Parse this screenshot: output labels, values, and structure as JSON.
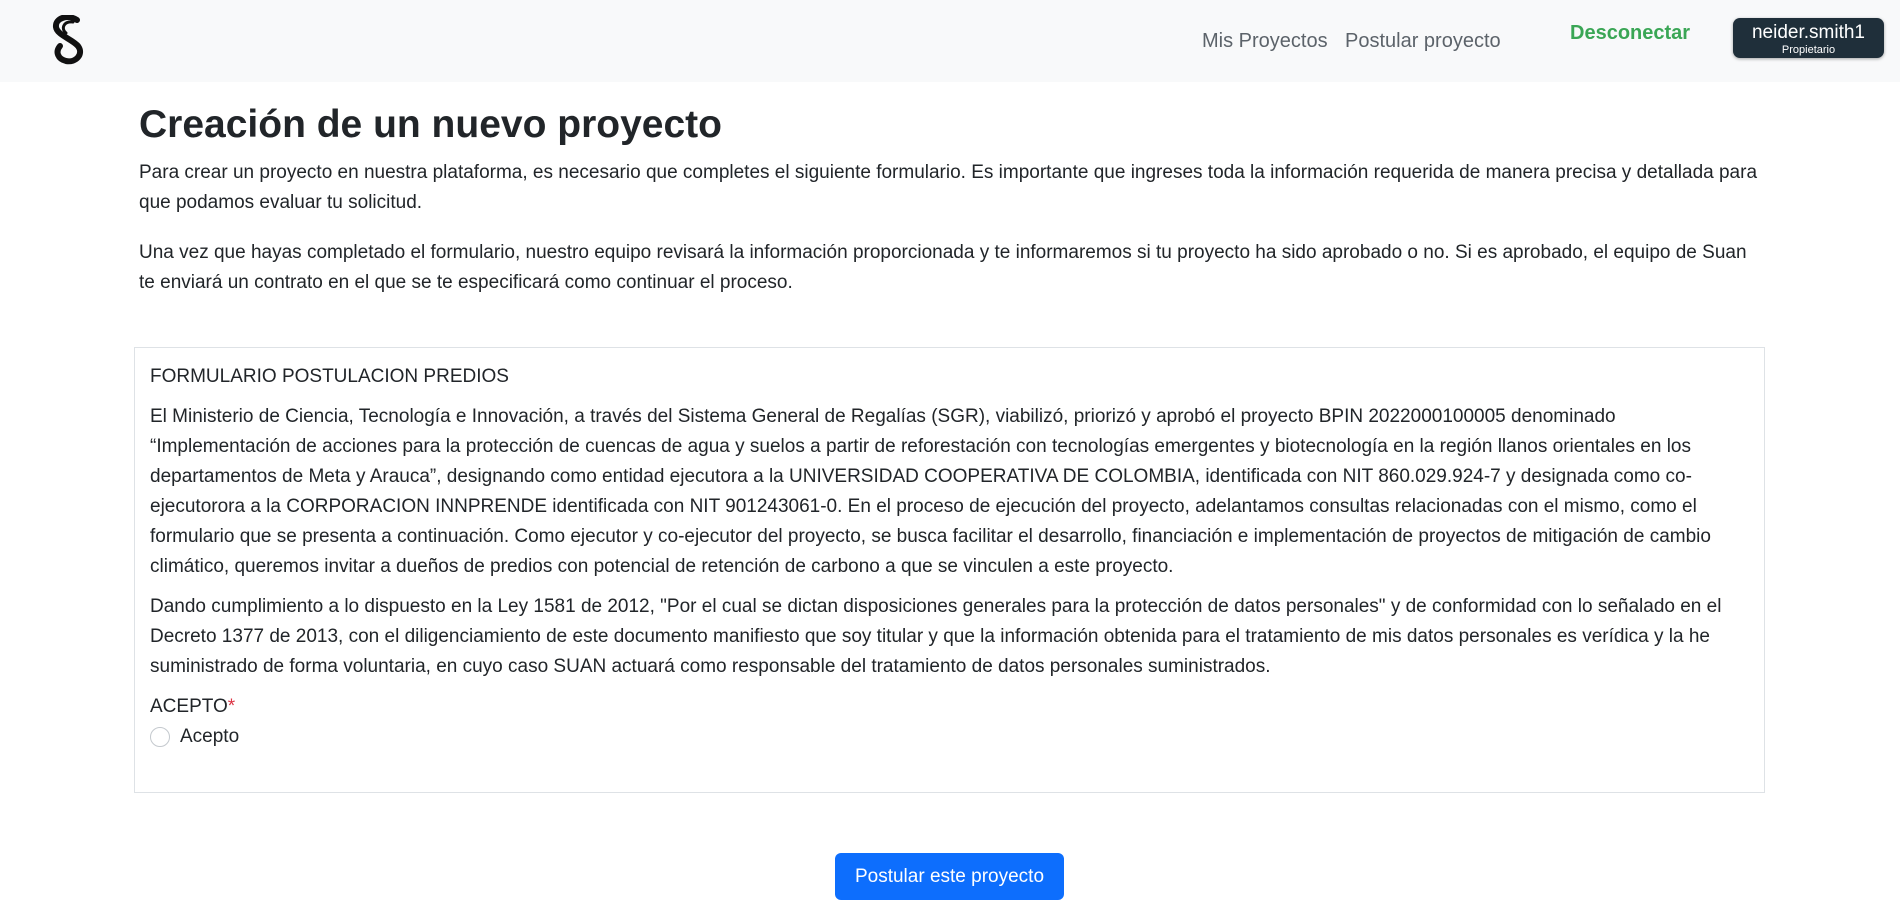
{
  "header": {
    "logo_icon": "suan-s-logo-icon",
    "nav": {
      "my_projects": "Mis Proyectos",
      "apply_project": "Postular proyecto",
      "logout": "Desconectar"
    },
    "user": {
      "name": "neider.smith1",
      "role": "Propietario"
    }
  },
  "page": {
    "title": "Creación de un nuevo proyecto",
    "intro_1": "Para crear un proyecto en nuestra plataforma, es necesario que completes el siguiente formulario. Es importante que ingreses toda la información requerida de manera precisa y detallada para que podamos evaluar tu solicitud.",
    "intro_2": "Una vez que hayas completado el formulario, nuestro equipo revisará la información proporcionada y te informaremos si tu proyecto ha sido aprobado o no. Si es aprobado, el equipo de Suan te enviará un contrato en el que se te especificará como continuar el proceso."
  },
  "form": {
    "title": "FORMULARIO POSTULACION PREDIOS",
    "paragraph_1": "El Ministerio de Ciencia, Tecnología e Innovación, a través del Sistema General de Regalías (SGR), viabilizó, priorizó y aprobó el proyecto BPIN 2022000100005 denominado “Implementación de acciones para la protección de cuencas de agua y suelos a partir de reforestación con tecnologías emergentes y biotecnología en la región llanos orientales en los departamentos de Meta y Arauca”, designando como entidad ejecutora a la UNIVERSIDAD COOPERATIVA DE COLOMBIA, identificada con NIT 860.029.924-7 y designada como co-ejecutorora a la CORPORACION INNPRENDE identificada con NIT 901243061-0. En el proceso de ejecución del proyecto, adelantamos consultas relacionadas con el mismo, como el formulario que se presenta a continuación. Como ejecutor y co-ejecutor del proyecto, se busca facilitar el desarrollo, financiación e implementación de proyectos de mitigación de cambio climático, queremos invitar a dueños de predios con potencial de retención de carbono a que se vinculen a este proyecto.",
    "paragraph_2": "Dando cumplimiento a lo dispuesto en la Ley 1581 de 2012, \"Por el cual se dictan disposiciones generales para la protección de datos personales\" y de conformidad con lo señalado en el Decreto 1377 de 2013, con el diligenciamiento de este documento manifiesto que soy titular y que la información obtenida para el tratamiento de mis datos personales es verídica y la he suministrado de forma voluntaria, en cuyo caso SUAN actuará como responsable del tratamiento de datos personales suministrados.",
    "accept_label": "ACEPTO",
    "required_mark": "*",
    "accept_option": "Acepto",
    "accept_checked": false
  },
  "actions": {
    "submit_label": "Postular este proyecto"
  }
}
